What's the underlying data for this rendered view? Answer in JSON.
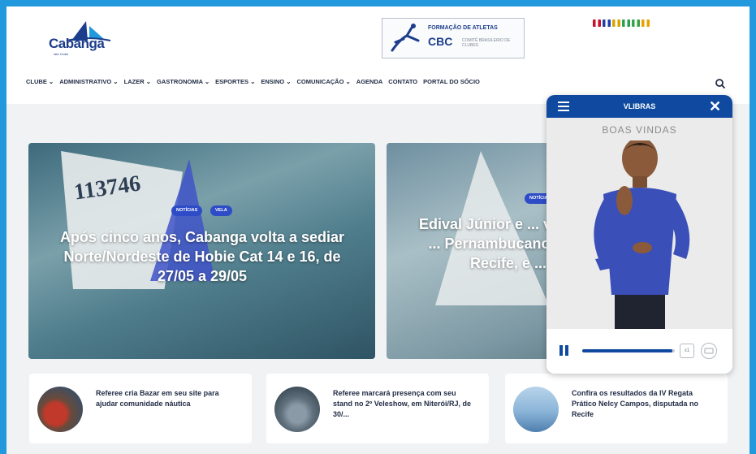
{
  "header": {
    "logo_text": "Cabanga",
    "logo_sub": "Iate Clube",
    "banner": {
      "line1": "FORMAÇÃO DE ATLETAS",
      "line2": "CBC",
      "sub": "COMITÊ BRASILEIRO DE CLUBES"
    },
    "flags": [
      {
        "name": "flag-uk-icon",
        "color": "#c8102e"
      },
      {
        "name": "flag-france-icon",
        "color": "#1f3fa6"
      },
      {
        "name": "flag-germany-icon",
        "color": "#d9a400"
      },
      {
        "name": "flag-italy-icon",
        "color": "#2e9e4f"
      },
      {
        "name": "flag-portugal-icon",
        "color": "#3aa34a"
      },
      {
        "name": "flag-spain-icon",
        "color": "#e8a000"
      }
    ]
  },
  "nav": {
    "items": [
      "CLUBE ⌄",
      "ADMINISTRATIVO ⌄",
      "LAZER ⌄",
      "GASTRONOMIA ⌄",
      "ESPORTES ⌄",
      "ENSINO ⌄",
      "COMUNICAÇÃO ⌄",
      "AGENDA",
      "CONTATO",
      "PORTAL DO SÓCIO"
    ]
  },
  "hero": {
    "card1": {
      "sail_number": "113746",
      "badges": [
        "NOTÍCIAS",
        "VELA"
      ],
      "title": "Após cinco anos, Cabanga volta a sediar Norte/Nordeste de Hobie Cat 14 e 16, de 27/05 a 29/05"
    },
    "card2": {
      "badges": [
        "NOTÍCIAS"
      ],
      "title": "Edival Júnior e ... vencem ... Pernambucano ... no Recife, e ..."
    }
  },
  "mini_cards": [
    {
      "text": "Referee cria Bazar em seu site para ajudar comunidade náutica"
    },
    {
      "text": "Referee marcará presença com seu stand no 2º Veleshow, em Niterói/RJ, de 30/..."
    },
    {
      "text": "Confira os resultados da IV Regata Prático Nelcy Campos, disputada no Recife"
    }
  ],
  "vlibras": {
    "title": "VLIBRAS",
    "caption": "BOAS VINDAS",
    "speed_label": "x1",
    "progress": 0.97
  },
  "colors": {
    "accent": "#2299dd",
    "vlibras_blue": "#0f4aa0",
    "badge": "#2f4cc8"
  }
}
